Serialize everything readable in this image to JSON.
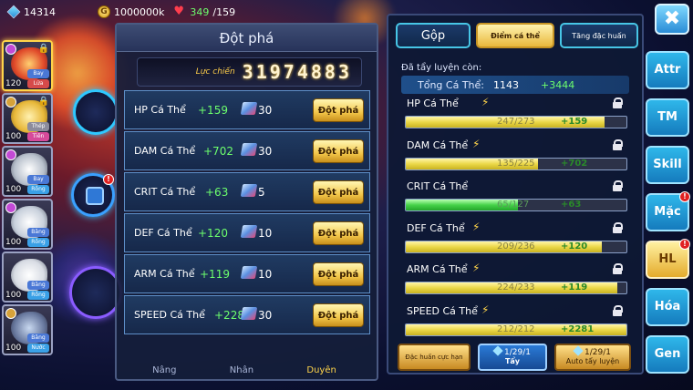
{
  "topbar": {
    "gems": "14314",
    "gold": "1000000k",
    "stamina_current": "349",
    "stamina_max": "/159"
  },
  "pets": [
    {
      "level": "120",
      "tag1": "Bay",
      "tag2": "Lửa",
      "tag1_color": "blue",
      "tag2_color": "red"
    },
    {
      "level": "100",
      "tag1": "Thép",
      "tag2": "Tiên",
      "tag1_color": "gray",
      "tag2_color": "pink"
    },
    {
      "level": "100",
      "tag1": "Bay",
      "tag2": "Rồng"
    },
    {
      "level": "100",
      "tag1": "Băng",
      "tag2": "Rồng"
    },
    {
      "level": "100",
      "tag1": "Băng",
      "tag2": "Rồng"
    },
    {
      "level": "100",
      "tag1": "Băng",
      "tag2": "Nước"
    }
  ],
  "dotpha": {
    "title": "Đột phá",
    "power_label": "Lực chiến",
    "power_value": "31974883",
    "rows": [
      {
        "name": "HP Cá Thể",
        "bonus": "+159",
        "qty": "30",
        "button": "Đột phá"
      },
      {
        "name": "DAM Cá Thể",
        "bonus": "+702",
        "qty": "30",
        "button": "Đột phá"
      },
      {
        "name": "CRIT Cá Thể",
        "bonus": "+63",
        "qty": "5",
        "button": "Đột phá"
      },
      {
        "name": "DEF Cá Thể",
        "bonus": "+120",
        "qty": "10",
        "button": "Đột phá"
      },
      {
        "name": "ARM Cá Thể",
        "bonus": "+119",
        "qty": "10",
        "button": "Đột phá"
      },
      {
        "name": "SPEED Cá Thể",
        "bonus": "+2281",
        "qty": "30",
        "button": "Đột phá"
      }
    ],
    "bottom_tabs": [
      "Nâng",
      "Nhân",
      "Duyên"
    ]
  },
  "attr": {
    "tabs": {
      "merge": "Gộp",
      "individual": "Điểm cá thể",
      "special": "Tăng đặc huấn"
    },
    "remaining_label": "Đã tẩy luyện còn:",
    "total_label": "Tổng Cá Thể:",
    "total_value": "1143",
    "total_add": "+3444",
    "stats": [
      {
        "name": "HP Cá Thể",
        "value": "247/273",
        "add": "+159",
        "fill_pct": 0.9,
        "color": "#ebd848"
      },
      {
        "name": "DAM Cá Thể",
        "value": "135/225",
        "add": "+702",
        "fill_pct": 0.6,
        "color": "#ebd848"
      },
      {
        "name": "CRIT Cá Thể",
        "value": "65/127",
        "add": "+63",
        "fill_pct": 0.51,
        "color": "#46d24a"
      },
      {
        "name": "DEF Cá Thể",
        "value": "209/236",
        "add": "+120",
        "fill_pct": 0.89,
        "color": "#ebd848"
      },
      {
        "name": "ARM Cá Thể",
        "value": "224/233",
        "add": "+119",
        "fill_pct": 0.96,
        "color": "#ebd848"
      },
      {
        "name": "SPEED Cá Thể",
        "value": "212/212",
        "add": "+2281",
        "fill_pct": 1.0,
        "color": "#ebd848"
      }
    ],
    "bottom": {
      "special_label": "Đặc huấn cực hạn",
      "wash_count": "1/29/1",
      "wash_label": "Tẩy",
      "auto_count": "1/29/1",
      "auto_label": "Auto tẩy luyện"
    }
  },
  "menu": {
    "close": "✖",
    "items": [
      {
        "label": "Attr",
        "badge": false,
        "active": false
      },
      {
        "label": "TM",
        "badge": false,
        "active": false
      },
      {
        "label": "Skill",
        "badge": false,
        "active": false
      },
      {
        "label": "Mặc",
        "badge": true,
        "active": false
      },
      {
        "label": "HL",
        "badge": true,
        "active": true
      },
      {
        "label": "Hóa",
        "badge": false,
        "active": false
      },
      {
        "label": "Gen",
        "badge": false,
        "active": false
      }
    ]
  },
  "colors": {
    "accent_gold": "#f3c74a",
    "accent_cyan": "#47c6e6",
    "bonus_green": "#6dff6d"
  }
}
